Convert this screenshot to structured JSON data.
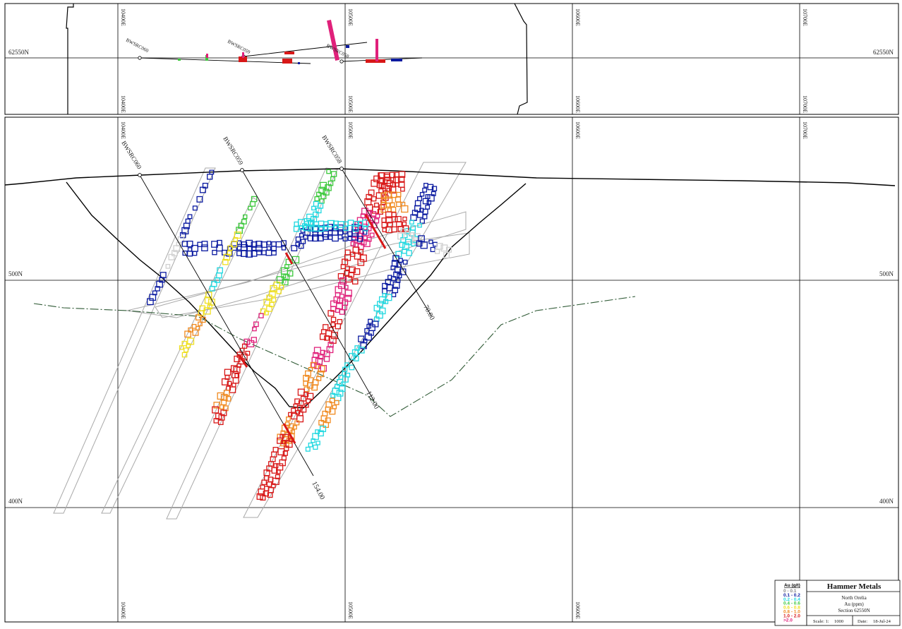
{
  "plan": {
    "northing_label": "62550N",
    "eastings": [
      "10400E",
      "10500E",
      "10600E",
      "10700E"
    ],
    "holes": [
      "BWSRC060",
      "BWSRC059",
      "BWSRC058"
    ]
  },
  "section": {
    "eastings": [
      "10400E",
      "10500E",
      "10600E",
      "10700E"
    ],
    "northings": [
      "500N",
      "400N"
    ],
    "holes": [
      {
        "name": "BWSRC060",
        "depth": "154.00"
      },
      {
        "name": "BWSRC059",
        "depth": "112.00"
      },
      {
        "name": "BWSRC058",
        "depth": "70.00"
      }
    ]
  },
  "legend": {
    "title": "Au (g/t)",
    "items": [
      {
        "label": "0 - 0.1",
        "color": "#d0d0d0"
      },
      {
        "label": "0.1 - 0.2",
        "color": "#0a1aa0"
      },
      {
        "label": "0.2 - 0.4",
        "color": "#21d8e0"
      },
      {
        "label": "0.4 - 0.6",
        "color": "#3cc83c"
      },
      {
        "label": "0.6 - 0.8",
        "color": "#f0e020"
      },
      {
        "label": "0.8 - 1.0",
        "color": "#f08a20"
      },
      {
        "label": "1.0 - 2.0",
        "color": "#d81818"
      },
      {
        "label": ">2.0",
        "color": "#e0207a"
      }
    ]
  },
  "title_block": {
    "company": "Hammer Metals",
    "project": "North Orelia",
    "element": "Au (ppm)",
    "section": "Section 62550N",
    "scale_label": "Scale: 1:",
    "scale_value": "1000",
    "date_label": "Date:",
    "date_value": "18-Jul-24"
  }
}
